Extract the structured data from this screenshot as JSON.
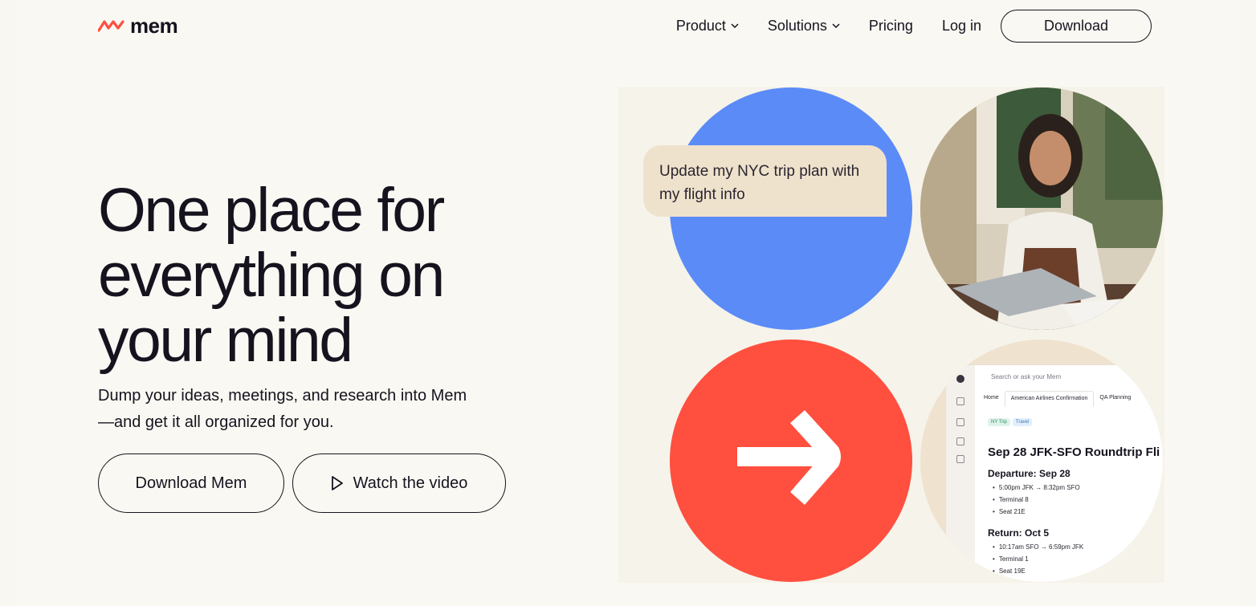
{
  "brand": {
    "name": "mem",
    "color": "#ff4f3f"
  },
  "nav": {
    "product": "Product",
    "solutions": "Solutions",
    "pricing": "Pricing",
    "login": "Log in",
    "download": "Download"
  },
  "hero": {
    "title_line1": "One place for",
    "title_line2": "everything on",
    "title_line3": "your mind",
    "subtitle": "Dump your ideas, meetings, and research into Mem—and get it all organized for you.",
    "primary_button": "Download Mem",
    "secondary_button": "Watch the video"
  },
  "visual": {
    "chat_bubble": "Update my NYC trip plan with my flight info",
    "colors": {
      "blue": "#5b8bf7",
      "red": "#ff4f3f",
      "beige": "#efe2cc"
    },
    "app": {
      "search_placeholder": "Search or ask your Mem",
      "tabs": [
        "Home",
        "American Airlines Confirmation",
        "QA Planning"
      ],
      "chips": [
        "NY Trip",
        "Travel"
      ],
      "heading": "Sep 28 JFK-SFO Roundtrip Fli",
      "departure_title": "Departure: Sep 28",
      "departure_items": [
        "5:00pm JFK → 8:32pm SFO",
        "Terminal 8",
        "Seat 21E"
      ],
      "return_title": "Return: Oct 5",
      "return_items": [
        "10:17am SFO → 6:59pm JFK",
        "Terminal 1",
        "Seat 19E"
      ]
    }
  }
}
